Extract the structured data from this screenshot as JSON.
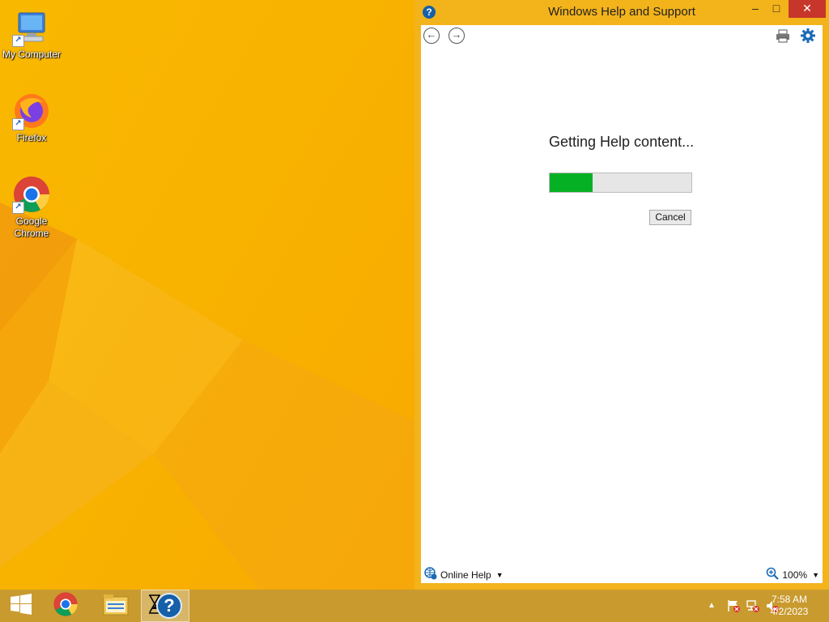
{
  "desktop": {
    "icons": [
      {
        "label": "My Computer",
        "icon": "computer-icon"
      },
      {
        "label": "Firefox",
        "icon": "firefox-icon"
      },
      {
        "label": "Google Chrome",
        "icon": "chrome-icon"
      }
    ]
  },
  "window": {
    "title": "Windows Help and Support",
    "minimize_glyph": "–",
    "maximize_glyph": "□",
    "close_glyph": "✕",
    "back_glyph": "←",
    "forward_glyph": "→",
    "loading_text": "Getting Help content...",
    "progress_percent": 30,
    "cancel_label": "Cancel",
    "online_help_label": "Online Help",
    "zoom_label": "100%"
  },
  "taskbar": {
    "items": [
      "start-icon",
      "chrome-icon",
      "file-explorer-icon",
      "help-icon"
    ],
    "time": "7:58 AM",
    "date": "4/2/2023"
  },
  "colors": {
    "accent": "#f3b31a",
    "progress": "#06b025",
    "close": "#c7362b"
  }
}
